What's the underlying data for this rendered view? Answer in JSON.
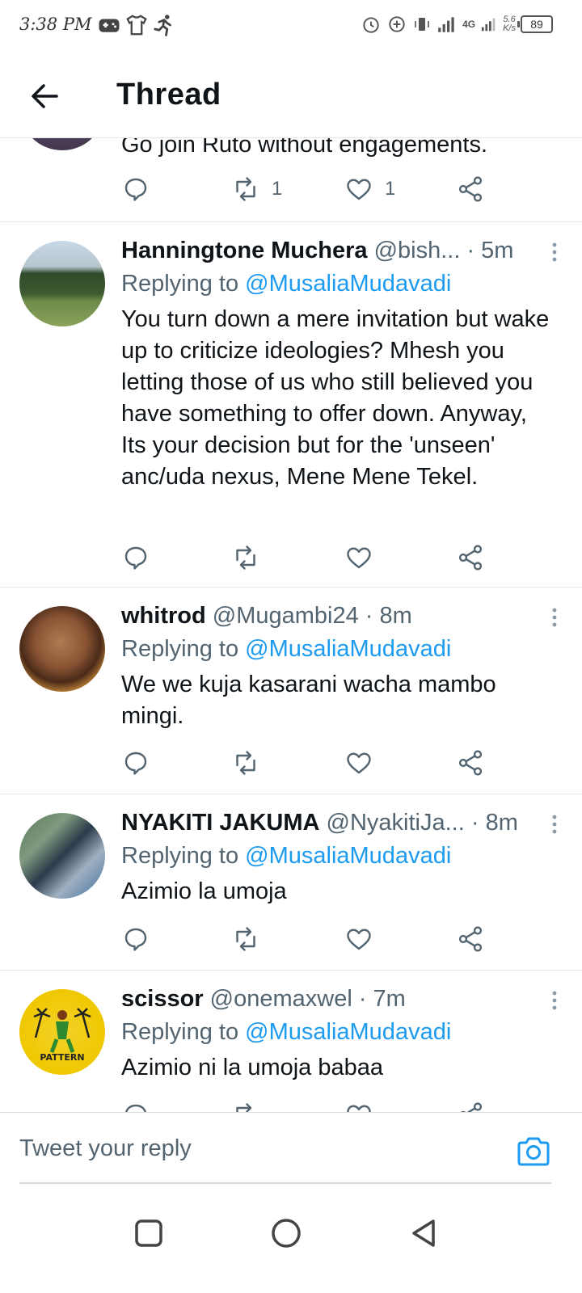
{
  "status_bar": {
    "time": "3:38 PM",
    "net_speed_top": "5.6",
    "net_speed_bottom": "K/s",
    "network": "4G",
    "battery": "89"
  },
  "header": {
    "title": "Thread"
  },
  "partial_tweet": {
    "text": "Go join Ruto without engagements.",
    "retweets": "1",
    "likes": "1"
  },
  "tweets": [
    {
      "name": "Hanningtone Muchera",
      "handle": "@bish...",
      "sep": " · ",
      "time": "5m",
      "replying_prefix": "Replying to ",
      "replying_to": "@MusaliaMudavadi",
      "text": "You turn down a mere invitation but wake up to criticize ideologies? Mhesh you letting those of us who still believed you have something to offer down. Anyway, Its your decision but for the 'unseen' anc/uda nexus, Mene Mene Tekel."
    },
    {
      "name": "whitrod",
      "handle": "@Mugambi24",
      "sep": " · ",
      "time": "8m",
      "replying_prefix": "Replying to ",
      "replying_to": "@MusaliaMudavadi",
      "text": "We we kuja kasarani wacha mambo mingi."
    },
    {
      "name": "NYAKITI JAKUMA",
      "handle": "@NyakitiJa...",
      "sep": " · ",
      "time": "8m",
      "replying_prefix": "Replying to ",
      "replying_to": "@MusaliaMudavadi",
      "text": "Azimio la umoja"
    },
    {
      "name": "scissor",
      "handle": "@onemaxwel",
      "sep": " · ",
      "time": "7m",
      "replying_prefix": "Replying to ",
      "replying_to": "@MusaliaMudavadi",
      "text": "Azimio ni la umoja babaa"
    }
  ],
  "reply_bar": {
    "placeholder": "Tweet your reply"
  },
  "colors": {
    "accent": "#1d9bf0",
    "secondary_text": "#536471",
    "primary_text": "#0f1419"
  }
}
